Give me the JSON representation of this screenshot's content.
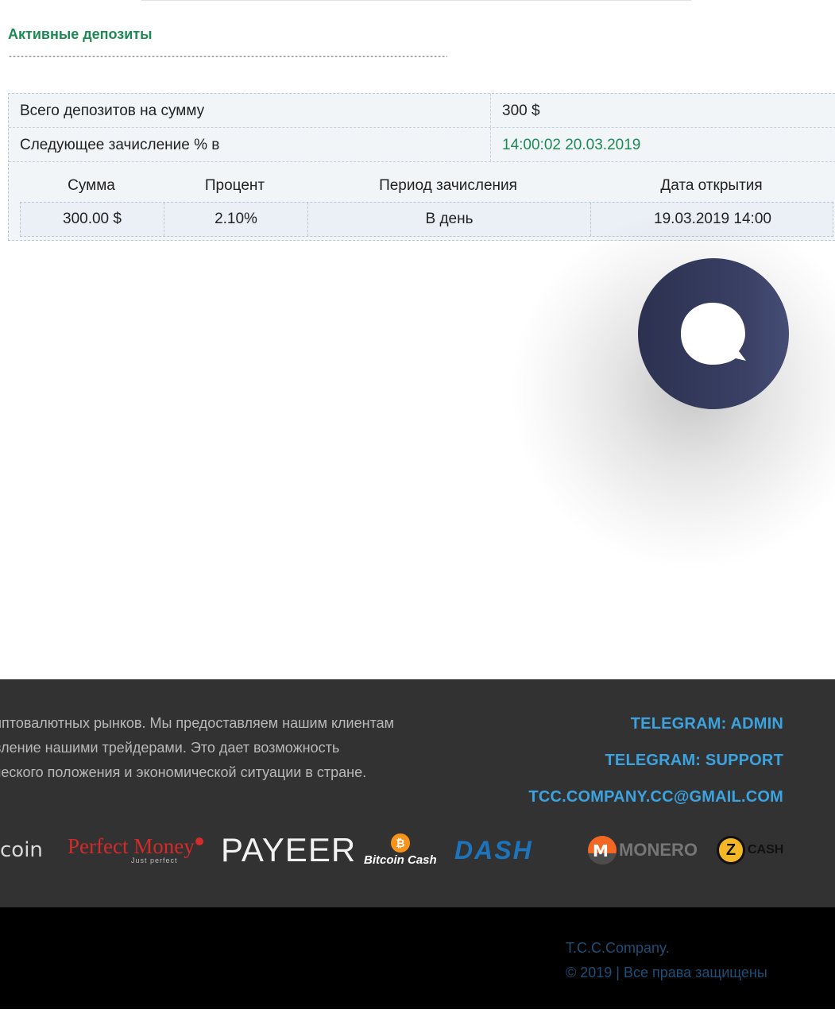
{
  "deposits": {
    "title": "Активные депозиты",
    "divider": "--------------------------------------------------------------------------------------------------------------------------------------------------------------",
    "summary": {
      "total_label": "Всего депозитов на сумму",
      "total_value": "300 $",
      "next_label": "Следующее зачисление % в",
      "next_value": "14:00:02 20.03.2019"
    },
    "table": {
      "headers": [
        "Сумма",
        "Процент",
        "Период зачисления",
        "Дата открытия"
      ],
      "rows": [
        [
          "300.00 $",
          "2.10%",
          "В день",
          "19.03.2019 14:00"
        ]
      ]
    }
  },
  "chat": {
    "icon": "chat-bubble-icon"
  },
  "footer": {
    "about_lines": [
      "иптовалютных рынков. Мы предоставляем нашим клиентам",
      "вление нашими трейдерами. Это дает возможность",
      "ческого положения и экономической ситуации в стране."
    ],
    "contacts": {
      "telegram_admin": "TELEGRAM: ADMIN",
      "telegram_support": "TELEGRAM: SUPPORT",
      "email": "TCC.COMPANY.CC@GMAIL.COM"
    },
    "payments": {
      "bitcoin": "coin",
      "perfect_money": "Perfect Money",
      "perfect_money_tagline": "Just perfect",
      "payeer": "PAYEER",
      "bitcoin_cash_symbol": "₿",
      "bitcoin_cash": "Bitcoin Cash",
      "dash": "DASH",
      "monero": "MONERO",
      "zcash_symbol": "Z",
      "zcash": "CASH"
    }
  },
  "bottom": {
    "company": "T.C.C.Company.",
    "rights": "© 2019 | Все права защищены"
  },
  "colors": {
    "accent_green": "#1d8a55",
    "link_blue": "#3ba3e0",
    "footer_bg": "#323232",
    "bottom_bg": "#000000",
    "chat_button": "#2c3150"
  }
}
